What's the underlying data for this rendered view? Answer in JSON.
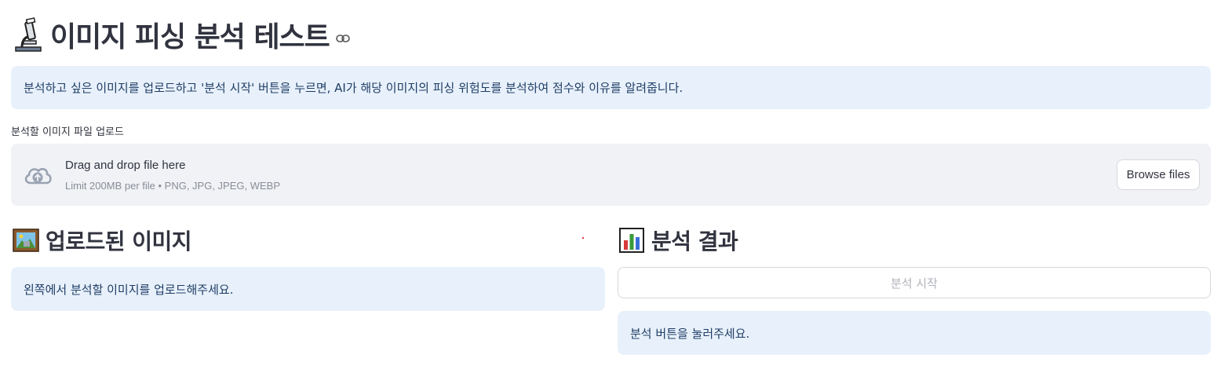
{
  "header": {
    "title_icon": "microscope-icon",
    "title": "이미지 피싱 분석 테스트",
    "link_icon": "link-icon"
  },
  "intro_info": {
    "text": "분석하고 싶은 이미지를 업로드하고 '분석 시작' 버튼을 누르면, AI가 해당 이미지의 피싱 위험도를 분석하여 점수와 이유를 알려줍니다."
  },
  "uploader": {
    "label": "분석할 이미지 파일 업로드",
    "icon": "cloud-upload-icon",
    "drop_text": "Drag and drop file here",
    "limit_text": "Limit 200MB per file • PNG, JPG, JPEG, WEBP",
    "browse_label": "Browse files"
  },
  "left_column": {
    "heading_icon": "framed-picture-icon",
    "heading": "업로드된 이미지",
    "info_text": "왼쪽에서 분석할 이미지를 업로드해주세요."
  },
  "right_column": {
    "heading_icon": "bar-chart-icon",
    "heading": "분석 결과",
    "analyze_button": "분석 시작",
    "info_text": "분석 버튼을 눌러주세요."
  },
  "colors": {
    "info_bg": "#e8f1fb",
    "info_text": "#1f3d66",
    "dropzone_bg": "#f0f2f6",
    "text": "#31333f",
    "muted": "#8a8d97"
  }
}
